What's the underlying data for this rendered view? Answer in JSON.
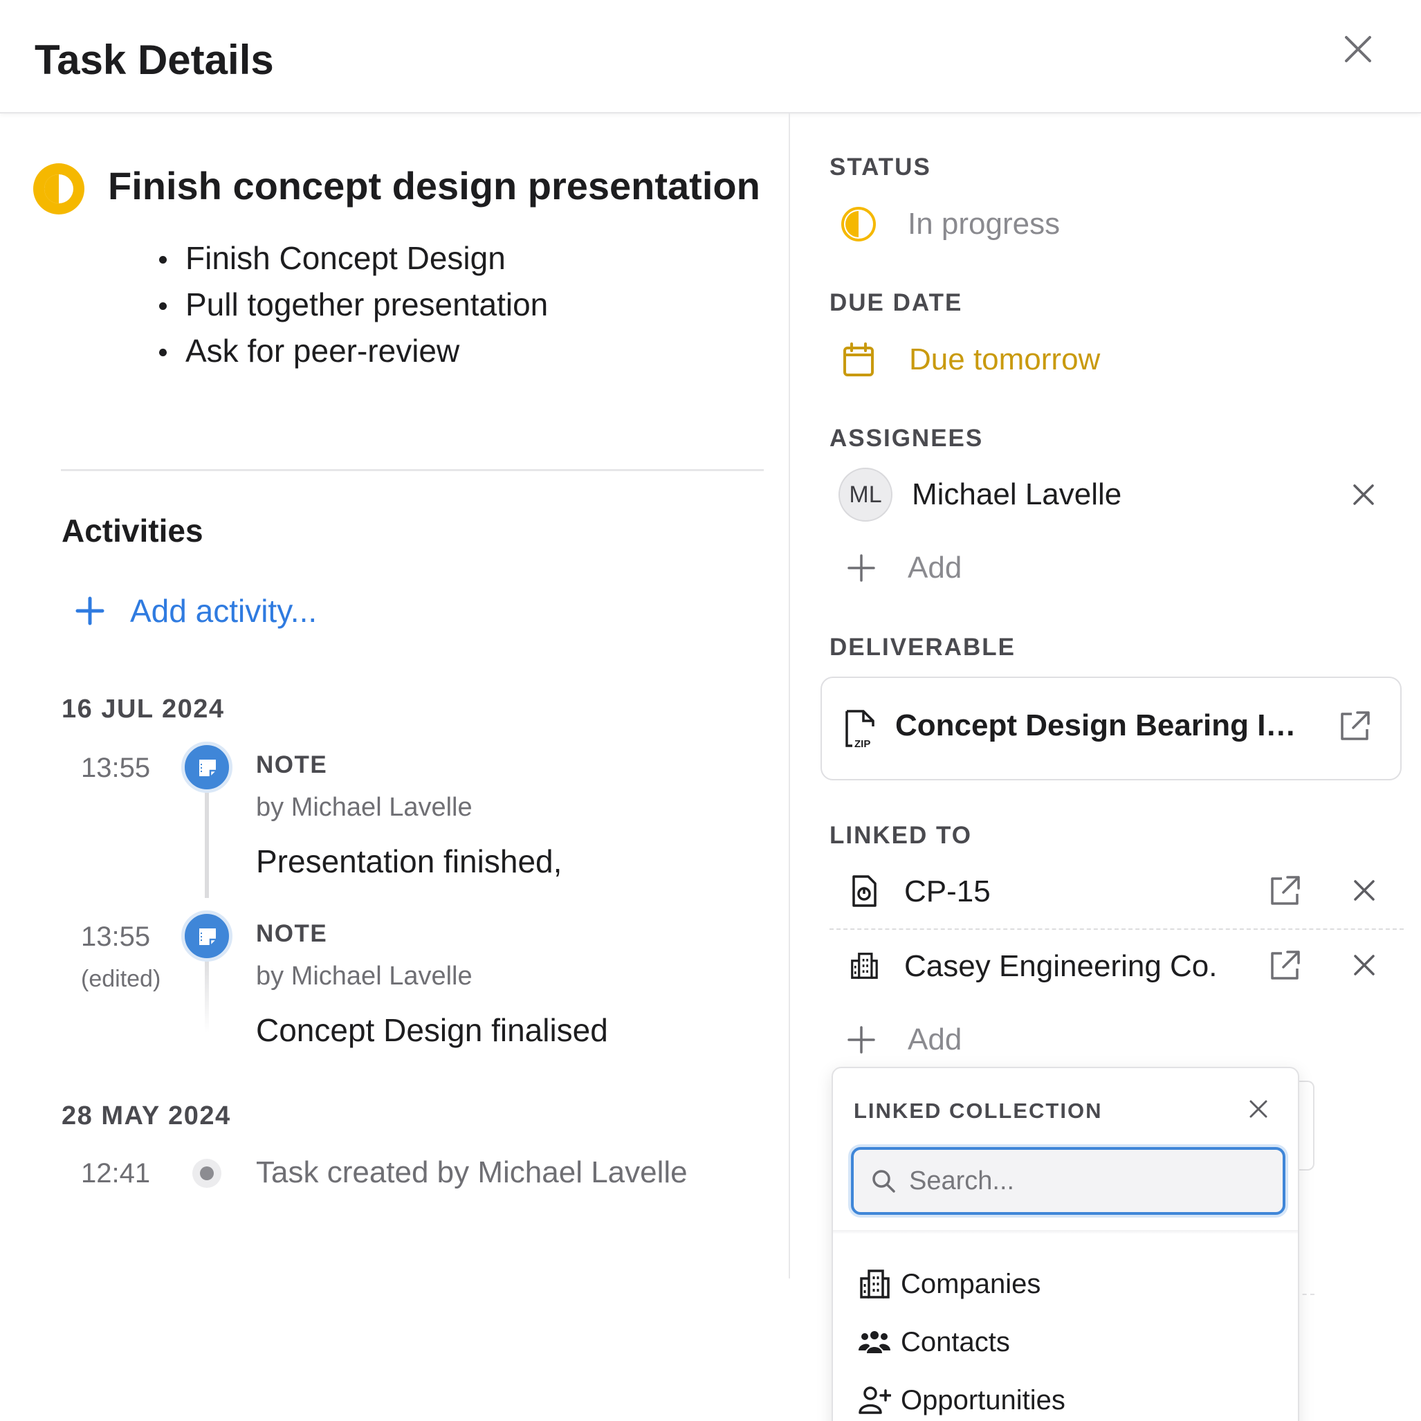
{
  "header": {
    "title": "Task Details",
    "close_icon": "close-icon"
  },
  "task": {
    "status_color": "#F5B800",
    "title": "Finish concept design presentation",
    "bullets": [
      "Finish Concept Design",
      "Pull together presentation",
      "Ask for peer-review"
    ]
  },
  "activities": {
    "title": "Activities",
    "add_label": "Add activity...",
    "groups": [
      {
        "date": "16 JUL 2024",
        "items": [
          {
            "time": "13:55",
            "edited": "",
            "kind": "NOTE",
            "by": "by Michael Lavelle",
            "text": "Presentation finished,"
          },
          {
            "time": "13:55",
            "edited": "(edited)",
            "kind": "NOTE",
            "by": "by Michael Lavelle",
            "text": "Concept Design finalised"
          }
        ]
      },
      {
        "date": "28 MAY 2024",
        "items": [
          {
            "time": "12:41",
            "text": "Task created by Michael Lavelle"
          }
        ]
      }
    ]
  },
  "sidebar": {
    "status": {
      "label": "STATUS",
      "value": "In progress"
    },
    "due_date": {
      "label": "DUE DATE",
      "value": "Due tomorrow",
      "color": "#C99A0E"
    },
    "assignees": {
      "label": "ASSIGNEES",
      "items": [
        {
          "initials": "ML",
          "name": "Michael Lavelle"
        }
      ],
      "add_label": "Add"
    },
    "deliverable": {
      "label": "DELIVERABLE",
      "name": "Concept Design Bearing In...",
      "icon": "zip-file-icon"
    },
    "linked_to": {
      "label": "LINKED TO",
      "items": [
        {
          "icon": "document-icon",
          "name": "CP-15"
        },
        {
          "icon": "building-icon",
          "name": "Casey Engineering Co."
        }
      ],
      "add_label": "Add"
    }
  },
  "popover": {
    "title": "LINKED COLLECTION",
    "search_placeholder": "Search...",
    "search_value": "",
    "options": [
      {
        "icon": "building-icon",
        "label": "Companies"
      },
      {
        "icon": "contacts-icon",
        "label": "Contacts"
      },
      {
        "icon": "add-person-icon",
        "label": "Opportunities"
      }
    ]
  },
  "colors": {
    "accent": "#3F86D8",
    "warning": "#F5B800"
  }
}
